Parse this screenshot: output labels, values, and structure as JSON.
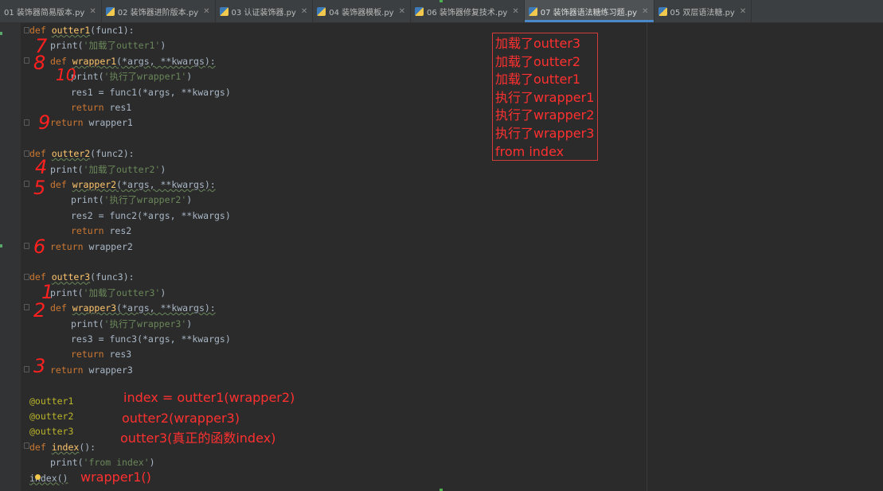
{
  "tabs": [
    {
      "label": "01 装饰器简易版本.py",
      "active": false
    },
    {
      "label": "02 装饰器进阶版本.py",
      "active": false
    },
    {
      "label": "03 认证装饰器.py",
      "active": false
    },
    {
      "label": "04 装饰器模板.py",
      "active": false
    },
    {
      "label": "06 装饰器修复技术.py",
      "active": false
    },
    {
      "label": "07 装饰器语法糖练习题.py",
      "active": true
    },
    {
      "label": "05 双层语法糖.py",
      "active": false
    }
  ],
  "code": {
    "l01_kw": "def ",
    "l01_fn": "outter1",
    "l01_rest": "(func1):",
    "l02_a": "print(",
    "l02_s": "'加载了outter1'",
    "l02_b": ")",
    "l03_kw": "def ",
    "l03_fn": "wrapper1",
    "l03_rest": "(*args, **kwargs):",
    "l04_a": "print(",
    "l04_s": "'执行了wrapper1'",
    "l04_b": ")",
    "l05": "res1 = func1(*args, **kwargs)",
    "l06_kw": "return ",
    "l06_rest": "res1",
    "l07_kw": "return ",
    "l07_rest": "wrapper1",
    "l09_kw": "def ",
    "l09_fn": "outter2",
    "l09_rest": "(func2):",
    "l10_a": "print(",
    "l10_s": "'加载了outter2'",
    "l10_b": ")",
    "l11_kw": "def ",
    "l11_fn": "wrapper2",
    "l11_rest": "(*args, **kwargs):",
    "l12_a": "print(",
    "l12_s": "'执行了wrapper2'",
    "l12_b": ")",
    "l13": "res2 = func2(*args, **kwargs)",
    "l14_kw": "return ",
    "l14_rest": "res2",
    "l15_kw": "return ",
    "l15_rest": "wrapper2",
    "l17_kw": "def ",
    "l17_fn": "outter3",
    "l17_rest": "(func3):",
    "l18_a": "print(",
    "l18_s": "'加载了outter3'",
    "l18_b": ")",
    "l19_kw": "def ",
    "l19_fn": "wrapper3",
    "l19_rest": "(*args, **kwargs):",
    "l20_a": "print(",
    "l20_s": "'执行了wrapper3'",
    "l20_b": ")",
    "l21": "res3 = func3(*args, **kwargs)",
    "l22_kw": "return ",
    "l22_rest": "res3",
    "l23_kw": "return ",
    "l23_rest": "wrapper3",
    "l25": "@outter1",
    "l26": "@outter2",
    "l27": "@outter3",
    "l28_kw": "def ",
    "l28_fn": "index",
    "l28_rest": "():",
    "l29_a": "print(",
    "l29_s": "'from index'",
    "l29_b": ")",
    "l30": "index()"
  },
  "annotations": {
    "box": [
      "加载了outter3",
      "加载了outter2",
      "加载了outter1",
      "执行了wrapper1",
      "执行了wrapper2",
      "执行了wrapper3",
      "from index"
    ],
    "a1": "index = outter1(wrapper2)",
    "a2": "outter2(wrapper3)",
    "a3": "outter3(真正的函数index)",
    "a4": "wrapper1()"
  },
  "handwritten": {
    "h1": "7",
    "h2": "8",
    "h3": "10",
    "h4": "9",
    "h5": "4",
    "h6": "5",
    "h7": "6",
    "h8": "1",
    "h9": "2",
    "h10": "3"
  }
}
